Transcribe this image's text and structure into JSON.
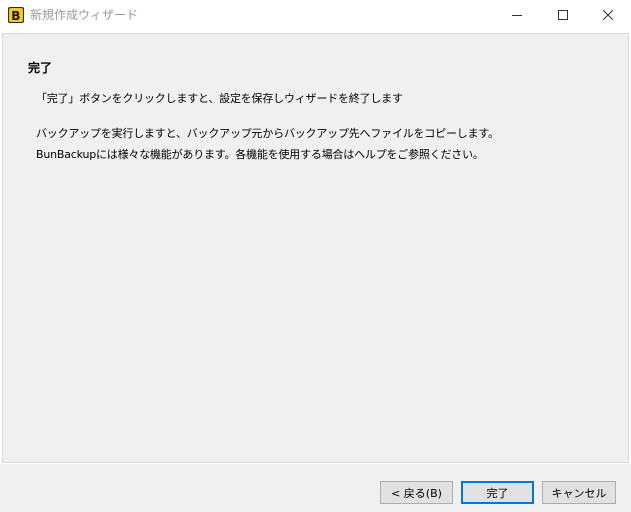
{
  "window": {
    "title": "新規作成ウィザード",
    "app_icon": "bunbackup-logo-icon",
    "controls": {
      "minimize": "minimize-icon",
      "maximize": "maximize-icon",
      "close": "close-icon"
    }
  },
  "content": {
    "heading": "完了",
    "line1": "「完了」ボタンをクリックしますと、設定を保存しウィザードを終了します",
    "line2": "バックアップを実行しますと、バックアップ元からバックアップ先へファイルをコピーします。",
    "line3": "BunBackupには様々な機能があります。各機能を使用する場合はヘルプをご参照ください。"
  },
  "buttons": {
    "back": "< 戻る(B)",
    "finish": "完了",
    "cancel": "キャンセル"
  },
  "colors": {
    "panel_bg": "#f0f0f0",
    "button_bg": "#e1e1e1",
    "default_button_border": "#0078d7",
    "title_text": "#999999"
  }
}
